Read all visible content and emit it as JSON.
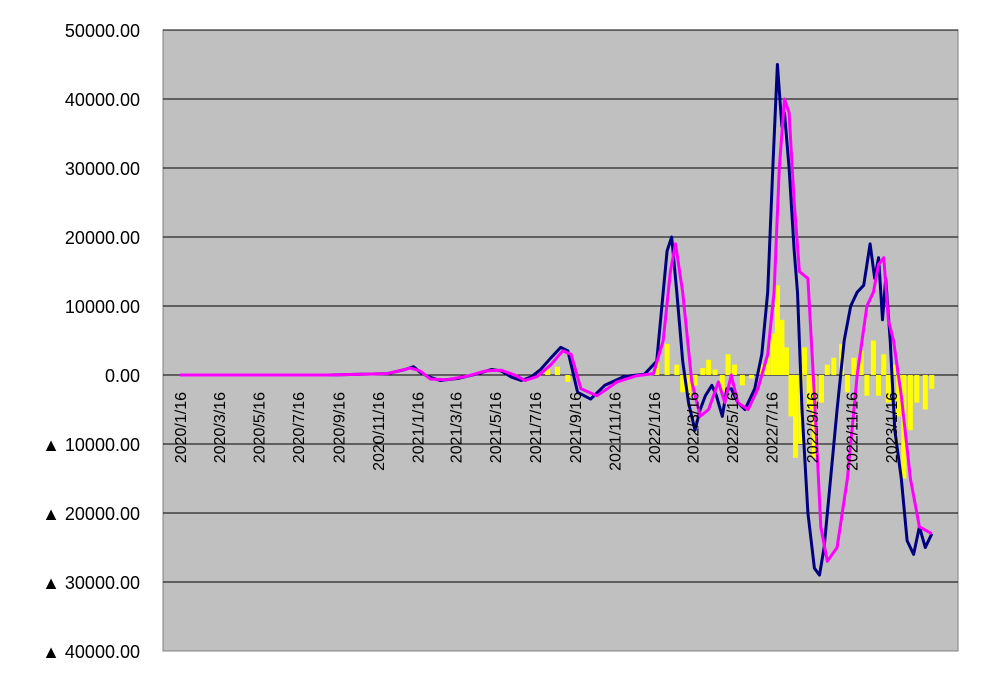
{
  "chart_data": {
    "type": "line",
    "title": "",
    "xlabel": "",
    "ylabel": "",
    "ylim": [
      -40000,
      50000
    ],
    "grid": "horizontal",
    "legend": "none",
    "colors": {
      "plot_background": "#c0c0c0",
      "daily": "#000080",
      "average": "#ff00ff",
      "difference": "#ffff00"
    },
    "y_ticks": [
      {
        "value": 50000,
        "label": "50000.00"
      },
      {
        "value": 40000,
        "label": "40000.00"
      },
      {
        "value": 30000,
        "label": "30000.00"
      },
      {
        "value": 20000,
        "label": "20000.00"
      },
      {
        "value": 10000,
        "label": "10000.00"
      },
      {
        "value": 0,
        "label": "0.00"
      },
      {
        "value": -10000,
        "label": "▲ 10000.00"
      },
      {
        "value": -20000,
        "label": "▲ 20000.00"
      },
      {
        "value": -30000,
        "label": "▲ 30000.00"
      },
      {
        "value": -40000,
        "label": "▲ 40000.00"
      }
    ],
    "x_ticks": [
      "2020/1/16",
      "2020/3/16",
      "2020/5/16",
      "2020/7/16",
      "2020/9/16",
      "2020/11/16",
      "2021/1/16",
      "2021/3/16",
      "2021/5/16",
      "2021/7/16",
      "2021/9/16",
      "2021/11/16",
      "2022/1/16",
      "2022/3/16",
      "2022/5/16",
      "2022/7/16",
      "2022/9/16",
      "2022/11/16",
      "2023/1/16"
    ],
    "x_range": [
      "2020/1/16",
      "2023/3/25"
    ],
    "series": [
      {
        "key": "daily",
        "style": "line",
        "x": [
          "2020/2/1",
          "2020/6/1",
          "2020/9/1",
          "2020/12/1",
          "2020/12/28",
          "2021/1/10",
          "2021/1/20",
          "2021/2/1",
          "2021/2/20",
          "2021/3/20",
          "2021/4/20",
          "2021/5/10",
          "2021/5/25",
          "2021/6/10",
          "2021/6/25",
          "2021/7/10",
          "2021/7/25",
          "2021/8/10",
          "2021/8/25",
          "2021/9/5",
          "2021/9/20",
          "2021/10/10",
          "2021/11/1",
          "2021/12/1",
          "2022/1/1",
          "2022/1/20",
          "2022/1/30",
          "2022/2/5",
          "2022/2/12",
          "2022/2/20",
          "2022/3/1",
          "2022/3/10",
          "2022/3/20",
          "2022/3/28",
          "2022/4/5",
          "2022/4/15",
          "2022/4/22",
          "2022/5/1",
          "2022/5/8",
          "2022/5/15",
          "2022/5/25",
          "2022/6/5",
          "2022/6/20",
          "2022/7/1",
          "2022/7/10",
          "2022/7/18",
          "2022/7/25",
          "2022/8/1",
          "2022/8/5",
          "2022/8/12",
          "2022/8/20",
          "2022/8/25",
          "2022/9/1",
          "2022/9/10",
          "2022/9/20",
          "2022/9/28",
          "2022/10/5",
          "2022/10/15",
          "2022/10/25",
          "2022/11/5",
          "2022/11/15",
          "2022/11/25",
          "2022/12/5",
          "2022/12/10",
          "2022/12/15",
          "2022/12/22",
          "2022/12/28",
          "2023/1/3",
          "2023/1/8",
          "2023/1/15",
          "2023/1/22",
          "2023/2/1",
          "2023/2/10",
          "2023/2/20",
          "2023/3/1",
          "2023/3/10",
          "2023/3/20"
        ],
        "values": [
          0,
          0,
          0,
          200,
          800,
          1200,
          400,
          -200,
          -800,
          -500,
          200,
          800,
          600,
          -300,
          -800,
          -300,
          800,
          2500,
          4000,
          3500,
          -2500,
          -3500,
          -1500,
          -200,
          100,
          2000,
          12000,
          18000,
          20000,
          12000,
          2000,
          -4000,
          -8000,
          -5000,
          -3000,
          -1500,
          -3000,
          -6000,
          -2000,
          -2000,
          -4000,
          -5000,
          -2000,
          3000,
          12000,
          30000,
          45000,
          36000,
          38000,
          30000,
          18000,
          12000,
          -5000,
          -20000,
          -28000,
          -29000,
          -25000,
          -15000,
          -5000,
          5000,
          10000,
          12000,
          13000,
          16000,
          19000,
          14000,
          17000,
          8000,
          14000,
          5000,
          -8000,
          -15000,
          -24000,
          -26000,
          -22000,
          -25000,
          -23000
        ]
      },
      {
        "key": "average",
        "style": "line",
        "x": [
          "2020/1/16",
          "2020/6/1",
          "2020/9/1",
          "2020/12/1",
          "2021/1/5",
          "2021/1/20",
          "2021/2/5",
          "2021/3/1",
          "2021/4/1",
          "2021/5/1",
          "2021/5/25",
          "2021/6/15",
          "2021/7/1",
          "2021/7/20",
          "2021/8/10",
          "2021/8/28",
          "2021/9/10",
          "2021/9/25",
          "2021/10/20",
          "2021/11/20",
          "2021/12/20",
          "2022/1/15",
          "2022/1/30",
          "2022/2/10",
          "2022/2/18",
          "2022/3/1",
          "2022/3/15",
          "2022/3/28",
          "2022/4/10",
          "2022/4/25",
          "2022/5/5",
          "2022/5/15",
          "2022/5/25",
          "2022/6/10",
          "2022/6/25",
          "2022/7/10",
          "2022/7/20",
          "2022/7/28",
          "2022/8/5",
          "2022/8/12",
          "2022/8/20",
          "2022/8/28",
          "2022/9/10",
          "2022/9/20",
          "2022/9/30",
          "2022/10/10",
          "2022/10/25",
          "2022/11/10",
          "2022/11/25",
          "2022/12/10",
          "2022/12/20",
          "2022/12/28",
          "2023/1/5",
          "2023/1/12",
          "2023/1/20",
          "2023/2/1",
          "2023/2/15",
          "2023/3/1",
          "2023/3/20"
        ],
        "values": [
          0,
          0,
          0,
          200,
          1000,
          600,
          -600,
          -700,
          -200,
          600,
          700,
          0,
          -800,
          -200,
          1500,
          3500,
          3000,
          -2000,
          -3000,
          -1000,
          -100,
          200,
          5000,
          15000,
          19000,
          12000,
          -1000,
          -6000,
          -5000,
          -1000,
          -4000,
          0,
          -4000,
          -5000,
          -2000,
          3000,
          12000,
          30000,
          40000,
          38000,
          25000,
          15000,
          14000,
          -3000,
          -22000,
          -27000,
          -25000,
          -15000,
          0,
          10000,
          12000,
          16000,
          17000,
          8000,
          5000,
          -3000,
          -15000,
          -22000,
          -23000
        ]
      },
      {
        "key": "difference",
        "style": "bar",
        "x": [
          "2021/8/5",
          "2021/8/20",
          "2021/9/5",
          "2022/1/20",
          "2022/2/5",
          "2022/2/20",
          "2022/3/1",
          "2022/3/10",
          "2022/3/20",
          "2022/4/1",
          "2022/4/10",
          "2022/4/20",
          "2022/5/1",
          "2022/5/10",
          "2022/5/20",
          "2022/6/1",
          "2022/6/15",
          "2022/7/1",
          "2022/7/10",
          "2022/7/18",
          "2022/7/25",
          "2022/8/1",
          "2022/8/8",
          "2022/8/15",
          "2022/8/22",
          "2022/8/30",
          "2022/9/5",
          "2022/9/12",
          "2022/9/20",
          "2022/10/1",
          "2022/10/10",
          "2022/10/20",
          "2022/11/1",
          "2022/11/10",
          "2022/11/20",
          "2022/12/1",
          "2022/12/10",
          "2022/12/20",
          "2022/12/28",
          "2023/1/5",
          "2023/1/12",
          "2023/1/20",
          "2023/1/28",
          "2023/2/5",
          "2023/2/15",
          "2023/2/25",
          "2023/3/10",
          "2023/3/20"
        ],
        "values": [
          800,
          1200,
          -1000,
          2000,
          4500,
          1500,
          -2500,
          -3000,
          -1500,
          1000,
          2200,
          800,
          -2500,
          3000,
          1500,
          -1500,
          -500,
          1500,
          2500,
          6000,
          13000,
          8000,
          4000,
          -6000,
          -12000,
          -10000,
          4000,
          -5000,
          -12000,
          -4000,
          1500,
          2500,
          4500,
          -2500,
          2500,
          3500,
          -3000,
          5000,
          -3000,
          3000,
          -4000,
          1500,
          -6000,
          -15000,
          -8000,
          -4000,
          -5000,
          -2000
        ]
      }
    ]
  }
}
